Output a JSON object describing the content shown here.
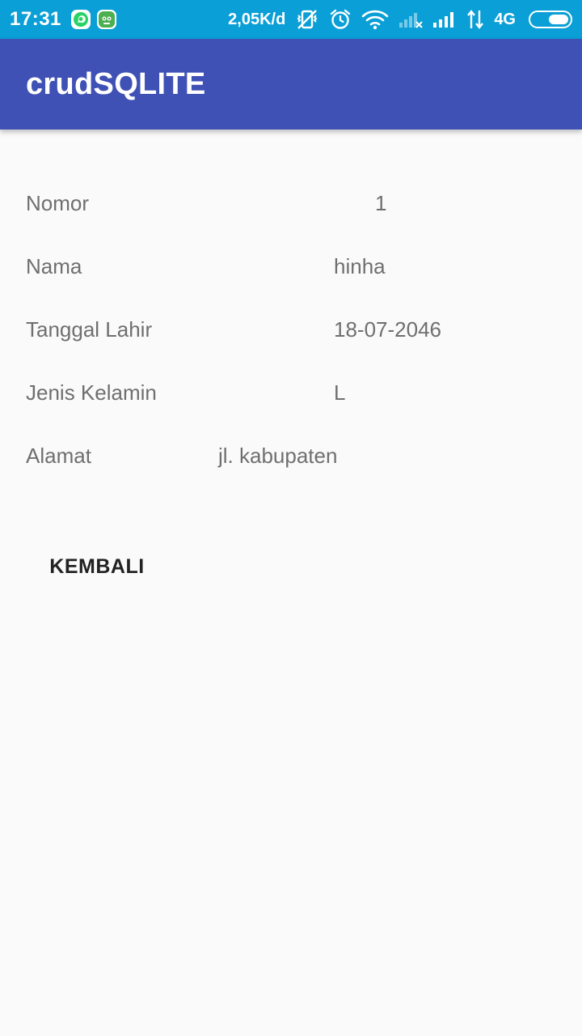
{
  "status_bar": {
    "time": "17:31",
    "net_speed": "2,05K/d",
    "network_type": "4G",
    "battery_level": 0.55,
    "notification_icons": [
      "whatsapp-icon",
      "android-bot-icon"
    ],
    "status_icons": [
      "vibrate-off-icon",
      "alarm-icon",
      "wifi-icon",
      "signal-sim1-no-icon",
      "signal-sim2-icon",
      "data-arrows-icon",
      "battery-icon"
    ]
  },
  "app_bar": {
    "title": "crudSQLITE"
  },
  "details": {
    "nomor": {
      "label": "Nomor",
      "value": "1"
    },
    "nama": {
      "label": "Nama",
      "value": "hinha"
    },
    "tanggal_lahir": {
      "label": "Tanggal Lahir",
      "value": "18-07-2046"
    },
    "jenis_kelamin": {
      "label": "Jenis Kelamin",
      "value": "L"
    },
    "alamat": {
      "label": "Alamat",
      "value": "jl. kabupaten"
    }
  },
  "actions": {
    "back_label": "KEMBALI"
  },
  "colors": {
    "status_bar": "#0a9fd6",
    "app_bar": "#3f51b5",
    "background": "#fafafa",
    "text_secondary": "#6f6f6f"
  }
}
